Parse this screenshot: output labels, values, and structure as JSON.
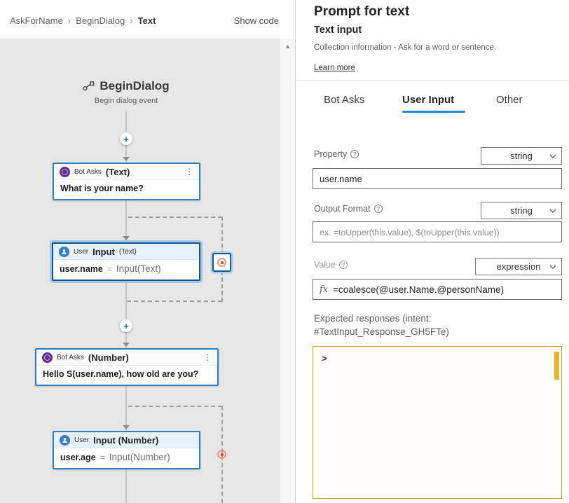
{
  "header": {
    "breadcrumb": [
      "AskForName",
      "BeginDialog",
      "Text"
    ],
    "show_code": "Show code"
  },
  "canvas": {
    "trigger": {
      "title": "BeginDialog",
      "subtitle": "Begin dialog event"
    },
    "nodes": [
      {
        "kind": "bot",
        "prefix": "Bot Asks",
        "emphasis": "(Text)",
        "body": "What is your name?"
      },
      {
        "kind": "user",
        "prefix": "User",
        "emphasis": "Input",
        "suffix": "(Text)",
        "body_left": "user.name",
        "body_op": "=",
        "body_right": "Input(Text)"
      },
      {
        "kind": "bot",
        "prefix": "Bot Asks",
        "emphasis": "(Number)",
        "body": "Hello S(user.name), how old are you?"
      },
      {
        "kind": "user",
        "prefix": "User",
        "emphasis": "Input (Number)",
        "body_left": "user.age",
        "body_op": "=",
        "body_right": "Input(Number)"
      }
    ]
  },
  "panel": {
    "title": "Prompt for text",
    "subtitle": "Text input",
    "description": "Collection information - Ask for a word or sentence.",
    "learn_more": "Learn more",
    "tabs": [
      {
        "label": "Bot Asks",
        "active": false
      },
      {
        "label": "User Input",
        "active": true
      },
      {
        "label": "Other",
        "active": false
      }
    ],
    "fields": {
      "property": {
        "label": "Property",
        "type": "string",
        "value": "user.name"
      },
      "output_format": {
        "label": "Output Format",
        "type": "string",
        "placeholder": "ex. =toUpper(this.value), $(toUpper(this.value))"
      },
      "value": {
        "label": "Value",
        "type": "expression",
        "prefix": "fx",
        "value": "=coalesce(@user.Name.@personName)"
      }
    },
    "expected_responses": {
      "label": "Expected responses (intent: #TextInput_Response_GH5FTe)",
      "prompt": ">"
    },
    "colors": {
      "accent": "#2b88d8",
      "node_border": "#2e7fc2",
      "bot_icon": "#5c2e91",
      "user_icon": "#2d7cd0",
      "gold_border": "#cda715",
      "gold_thumb": "#ecb322",
      "loop_marker": "#d83b01",
      "canvas_bg": "#e6e6e6"
    }
  }
}
